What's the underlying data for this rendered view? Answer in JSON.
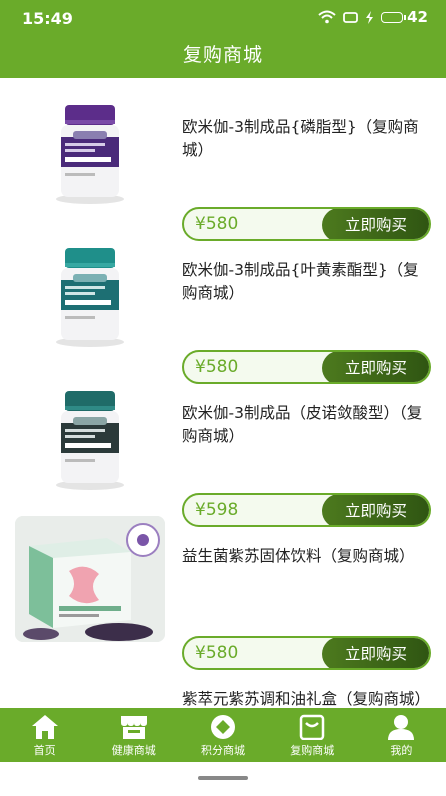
{
  "status_bar": {
    "time": "15:49",
    "battery": "42"
  },
  "header": {
    "title": "复购商城"
  },
  "products": [
    {
      "name": "欧米伽-3制成品{磷脂型}（复购商城）",
      "price": "¥580",
      "buy_label": "立即购买"
    },
    {
      "name": "欧米伽-3制成品{叶黄素酯型}（复购商城）",
      "price": "¥580",
      "buy_label": "立即购买"
    },
    {
      "name": "欧米伽-3制成品（皮诺敛酸型）（复购商城）",
      "price": "¥598",
      "buy_label": "立即购买"
    },
    {
      "name": "益生菌紫苏固体饮料（复购商城）",
      "price": "¥580",
      "buy_label": "立即购买"
    },
    {
      "name": "紫萃元紫苏调和油礼盒（复购商城）",
      "price": "",
      "buy_label": ""
    }
  ],
  "tabbar": {
    "items": [
      {
        "label": "首页",
        "icon": "home-icon"
      },
      {
        "label": "健康商城",
        "icon": "store-icon"
      },
      {
        "label": "积分商城",
        "icon": "points-icon"
      },
      {
        "label": "复购商城",
        "icon": "shopping-bag-icon"
      },
      {
        "label": "我的",
        "icon": "user-icon"
      }
    ]
  },
  "colors": {
    "primary": "#6aab2a",
    "button_dark": "#2f5512",
    "price": "#6aab2a"
  }
}
